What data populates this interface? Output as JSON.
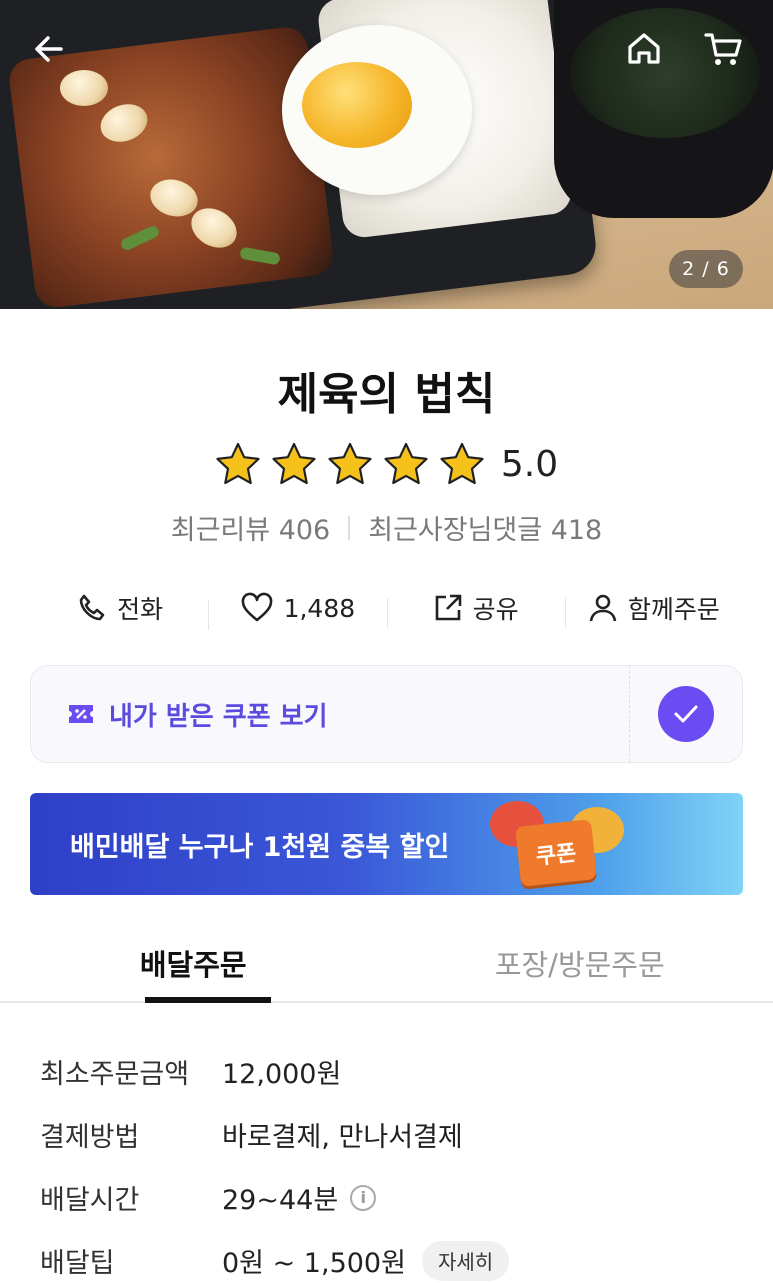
{
  "hero": {
    "pager": "2 / 6"
  },
  "header": {
    "icons": [
      "back-arrow-icon",
      "home-icon",
      "cart-icon"
    ]
  },
  "store": {
    "name": "제육의 법칙",
    "rating_value": "5.0",
    "rating_stars": 5,
    "recent_reviews": "최근리뷰 406",
    "recent_owner_replies": "최근사장님댓글 418"
  },
  "actions": {
    "call": "전화",
    "likes": "1,488",
    "share": "공유",
    "group_order": "함께주문"
  },
  "coupon": {
    "label": "내가 받은 쿠폰 보기"
  },
  "banner": {
    "text": "배민배달 누구나 1천원 중복 할인",
    "sign": "쿠폰"
  },
  "tabs": [
    {
      "label": "배달주문",
      "active": true
    },
    {
      "label": "포장/방문주문",
      "active": false
    }
  ],
  "info": {
    "min_order_label": "최소주문금액",
    "min_order_value": "12,000원",
    "payment_label": "결제방법",
    "payment_value": "바로결제, 만나서결제",
    "time_label": "배달시간",
    "time_value": "29~44분",
    "tip_label": "배달팁",
    "tip_value": "0원 ~ 1,500원",
    "tip_detail": "자세히"
  },
  "colors": {
    "accent": "#6a4cf2",
    "coupon_text": "#5b4bde",
    "star": "#f5c21b"
  }
}
